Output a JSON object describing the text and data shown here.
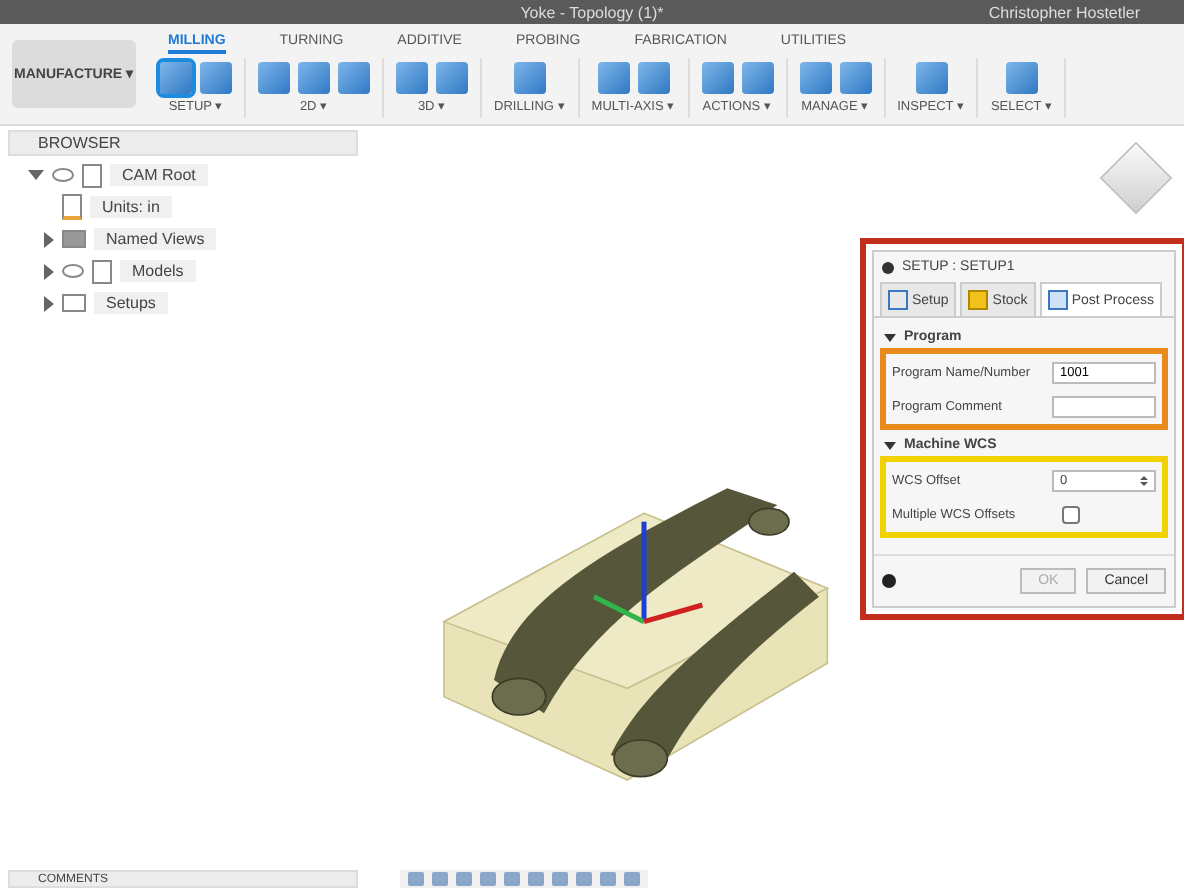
{
  "window": {
    "title": "Yoke - Topology (1)*",
    "user": "Christopher Hostetler"
  },
  "workspace": {
    "label": "MANUFACTURE ▾"
  },
  "tabs": [
    {
      "label": "MILLING",
      "selected": true
    },
    {
      "label": "TURNING",
      "selected": false
    },
    {
      "label": "ADDITIVE",
      "selected": false
    },
    {
      "label": "PROBING",
      "selected": false
    },
    {
      "label": "FABRICATION",
      "selected": false
    },
    {
      "label": "UTILITIES",
      "selected": false
    }
  ],
  "ribbon_groups": [
    {
      "label": "SETUP ▾"
    },
    {
      "label": "2D ▾"
    },
    {
      "label": "3D ▾"
    },
    {
      "label": "DRILLING ▾"
    },
    {
      "label": "MULTI-AXIS ▾"
    },
    {
      "label": "ACTIONS ▾"
    },
    {
      "label": "MANAGE ▾"
    },
    {
      "label": "INSPECT ▾"
    },
    {
      "label": "SELECT ▾"
    }
  ],
  "browser": {
    "title": "BROWSER",
    "tree": [
      {
        "label": "CAM Root",
        "expanded": true,
        "visible": true,
        "children": [
          {
            "label": "Units: in",
            "kind": "units"
          },
          {
            "label": "Named Views",
            "kind": "views",
            "expanded": false
          },
          {
            "label": "Models",
            "kind": "models",
            "expanded": false,
            "visible": true
          },
          {
            "label": "Setups",
            "kind": "setups",
            "expanded": false
          }
        ]
      }
    ]
  },
  "dialog": {
    "title": "SETUP : SETUP1",
    "tabs": [
      {
        "label": "Setup",
        "selected": false
      },
      {
        "label": "Stock",
        "selected": false
      },
      {
        "label": "Post Process",
        "selected": true
      }
    ],
    "sections": [
      {
        "title": "Program",
        "expanded": true,
        "fields": [
          {
            "kind": "text",
            "label": "Program Name/Number",
            "value": "1001"
          },
          {
            "kind": "text",
            "label": "Program Comment"
          }
        ]
      },
      {
        "title": "Machine WCS",
        "expanded": true,
        "fields": [
          {
            "kind": "spinner",
            "label": "WCS Offset",
            "value": "0"
          },
          {
            "kind": "checkbox",
            "label": "Multiple WCS Offsets",
            "checked": false
          }
        ]
      }
    ],
    "buttons": [
      {
        "label": "OK",
        "disabled": true
      },
      {
        "label": "Cancel",
        "disabled": false
      }
    ]
  },
  "comments": {
    "title": "COMMENTS"
  }
}
